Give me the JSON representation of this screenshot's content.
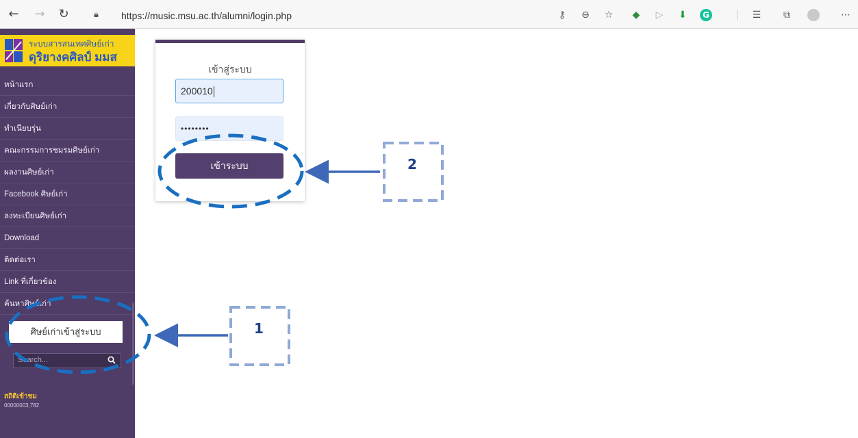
{
  "browser": {
    "url": "https://music.msu.ac.th/alumni/login.php",
    "icons": [
      "back-icon",
      "forward-icon",
      "refresh-icon",
      "lock-icon",
      "key-icon",
      "zoom-icon",
      "favorite-add-icon",
      "extension-icon",
      "play-icon",
      "download-icon",
      "grammarly-icon",
      "favorites-icon",
      "collections-icon",
      "profile-icon",
      "more-icon"
    ]
  },
  "sidebar": {
    "logo_line1": "ระบบสารสนเทศศิษย์เก่า",
    "logo_line2": "ดุริยางคศิลป์ มมส",
    "menu": [
      "หน้าแรก",
      "เกี่ยวกับศิษย์เก่า",
      "ทำเนียบรุ่น",
      "คณะกรรมการชมรมศิษย์เก่า",
      "ผลงานศิษย์เก่า",
      "Facebook ศิษย์เก่า",
      "ลงทะเบียนศิษย์เก่า",
      "Download",
      "ติดต่อเรา",
      "Link ที่เกี่ยวข้อง",
      "ค้นหาศิษย์เก่า"
    ],
    "login_button": "ศิษย์เก่าเข้าสู่ระบบ",
    "search_placeholder": "Search...",
    "stats_title": "สถิติเข้าชม",
    "stats_value": "00000003,782"
  },
  "login": {
    "title": "เข้าสู่ระบบ",
    "username": "200010",
    "password_mask": "••••••••",
    "submit": "เข้าระบบ"
  },
  "annotations": {
    "label1": "1",
    "label2": "2",
    "color": "#1a6fc0",
    "box_color": "#8fa8d8",
    "arrow_color": "#3f68b8"
  }
}
